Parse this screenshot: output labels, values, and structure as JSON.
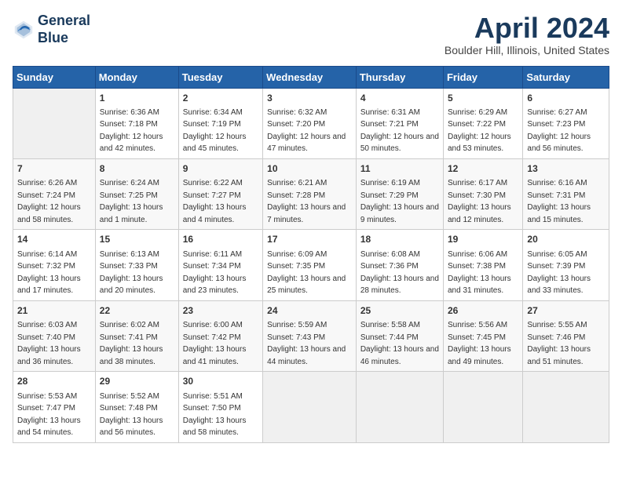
{
  "header": {
    "logo_line1": "General",
    "logo_line2": "Blue",
    "month": "April 2024",
    "location": "Boulder Hill, Illinois, United States"
  },
  "weekdays": [
    "Sunday",
    "Monday",
    "Tuesday",
    "Wednesday",
    "Thursday",
    "Friday",
    "Saturday"
  ],
  "weeks": [
    [
      {
        "day": "",
        "empty": true
      },
      {
        "day": "1",
        "sunrise": "6:36 AM",
        "sunset": "7:18 PM",
        "daylight": "12 hours and 42 minutes."
      },
      {
        "day": "2",
        "sunrise": "6:34 AM",
        "sunset": "7:19 PM",
        "daylight": "12 hours and 45 minutes."
      },
      {
        "day": "3",
        "sunrise": "6:32 AM",
        "sunset": "7:20 PM",
        "daylight": "12 hours and 47 minutes."
      },
      {
        "day": "4",
        "sunrise": "6:31 AM",
        "sunset": "7:21 PM",
        "daylight": "12 hours and 50 minutes."
      },
      {
        "day": "5",
        "sunrise": "6:29 AM",
        "sunset": "7:22 PM",
        "daylight": "12 hours and 53 minutes."
      },
      {
        "day": "6",
        "sunrise": "6:27 AM",
        "sunset": "7:23 PM",
        "daylight": "12 hours and 56 minutes."
      }
    ],
    [
      {
        "day": "7",
        "sunrise": "6:26 AM",
        "sunset": "7:24 PM",
        "daylight": "12 hours and 58 minutes."
      },
      {
        "day": "8",
        "sunrise": "6:24 AM",
        "sunset": "7:25 PM",
        "daylight": "13 hours and 1 minute."
      },
      {
        "day": "9",
        "sunrise": "6:22 AM",
        "sunset": "7:27 PM",
        "daylight": "13 hours and 4 minutes."
      },
      {
        "day": "10",
        "sunrise": "6:21 AM",
        "sunset": "7:28 PM",
        "daylight": "13 hours and 7 minutes."
      },
      {
        "day": "11",
        "sunrise": "6:19 AM",
        "sunset": "7:29 PM",
        "daylight": "13 hours and 9 minutes."
      },
      {
        "day": "12",
        "sunrise": "6:17 AM",
        "sunset": "7:30 PM",
        "daylight": "13 hours and 12 minutes."
      },
      {
        "day": "13",
        "sunrise": "6:16 AM",
        "sunset": "7:31 PM",
        "daylight": "13 hours and 15 minutes."
      }
    ],
    [
      {
        "day": "14",
        "sunrise": "6:14 AM",
        "sunset": "7:32 PM",
        "daylight": "13 hours and 17 minutes."
      },
      {
        "day": "15",
        "sunrise": "6:13 AM",
        "sunset": "7:33 PM",
        "daylight": "13 hours and 20 minutes."
      },
      {
        "day": "16",
        "sunrise": "6:11 AM",
        "sunset": "7:34 PM",
        "daylight": "13 hours and 23 minutes."
      },
      {
        "day": "17",
        "sunrise": "6:09 AM",
        "sunset": "7:35 PM",
        "daylight": "13 hours and 25 minutes."
      },
      {
        "day": "18",
        "sunrise": "6:08 AM",
        "sunset": "7:36 PM",
        "daylight": "13 hours and 28 minutes."
      },
      {
        "day": "19",
        "sunrise": "6:06 AM",
        "sunset": "7:38 PM",
        "daylight": "13 hours and 31 minutes."
      },
      {
        "day": "20",
        "sunrise": "6:05 AM",
        "sunset": "7:39 PM",
        "daylight": "13 hours and 33 minutes."
      }
    ],
    [
      {
        "day": "21",
        "sunrise": "6:03 AM",
        "sunset": "7:40 PM",
        "daylight": "13 hours and 36 minutes."
      },
      {
        "day": "22",
        "sunrise": "6:02 AM",
        "sunset": "7:41 PM",
        "daylight": "13 hours and 38 minutes."
      },
      {
        "day": "23",
        "sunrise": "6:00 AM",
        "sunset": "7:42 PM",
        "daylight": "13 hours and 41 minutes."
      },
      {
        "day": "24",
        "sunrise": "5:59 AM",
        "sunset": "7:43 PM",
        "daylight": "13 hours and 44 minutes."
      },
      {
        "day": "25",
        "sunrise": "5:58 AM",
        "sunset": "7:44 PM",
        "daylight": "13 hours and 46 minutes."
      },
      {
        "day": "26",
        "sunrise": "5:56 AM",
        "sunset": "7:45 PM",
        "daylight": "13 hours and 49 minutes."
      },
      {
        "day": "27",
        "sunrise": "5:55 AM",
        "sunset": "7:46 PM",
        "daylight": "13 hours and 51 minutes."
      }
    ],
    [
      {
        "day": "28",
        "sunrise": "5:53 AM",
        "sunset": "7:47 PM",
        "daylight": "13 hours and 54 minutes."
      },
      {
        "day": "29",
        "sunrise": "5:52 AM",
        "sunset": "7:48 PM",
        "daylight": "13 hours and 56 minutes."
      },
      {
        "day": "30",
        "sunrise": "5:51 AM",
        "sunset": "7:50 PM",
        "daylight": "13 hours and 58 minutes."
      },
      {
        "day": "",
        "empty": true
      },
      {
        "day": "",
        "empty": true
      },
      {
        "day": "",
        "empty": true
      },
      {
        "day": "",
        "empty": true
      }
    ]
  ],
  "labels": {
    "sunrise_prefix": "Sunrise: ",
    "sunset_prefix": "Sunset: ",
    "daylight_prefix": "Daylight: "
  }
}
